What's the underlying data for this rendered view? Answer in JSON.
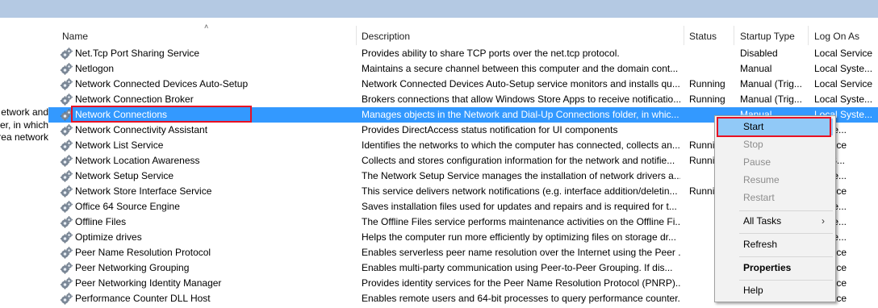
{
  "left_pane": {
    "lines": [
      "etwork and",
      "er, in which",
      "rea network"
    ]
  },
  "columns": {
    "name": "Name",
    "description": "Description",
    "status": "Status",
    "startup_type": "Startup Type",
    "log_on_as": "Log On As"
  },
  "services": [
    {
      "name": "Net.Tcp Port Sharing Service",
      "description": "Provides ability to share TCP ports over the net.tcp protocol.",
      "status": "",
      "startup": "Disabled",
      "logon": "Local Service"
    },
    {
      "name": "Netlogon",
      "description": "Maintains a secure channel between this computer and the domain cont...",
      "status": "",
      "startup": "Manual",
      "logon": "Local Syste..."
    },
    {
      "name": "Network Connected Devices Auto-Setup",
      "description": "Network Connected Devices Auto-Setup service monitors and installs qu...",
      "status": "Running",
      "startup": "Manual (Trig...",
      "logon": "Local Service"
    },
    {
      "name": "Network Connection Broker",
      "description": "Brokers connections that allow Windows Store Apps to receive notificatio...",
      "status": "Running",
      "startup": "Manual (Trig...",
      "logon": "Local Syste..."
    },
    {
      "name": "Network Connections",
      "description": "Manages objects in the Network and Dial-Up Connections folder, in whic...",
      "status": "",
      "startup": "Manual",
      "logon": "Local Syste..."
    },
    {
      "name": "Network Connectivity Assistant",
      "description": "Provides DirectAccess status notification for UI components",
      "status": "",
      "startup": "",
      "logon": "Syste..."
    },
    {
      "name": "Network List Service",
      "description": "Identifies the networks to which the computer has connected, collects an...",
      "status": "Runni",
      "startup": "",
      "logon": "Service"
    },
    {
      "name": "Network Location Awareness",
      "description": "Collects and stores configuration information for the network and notifie...",
      "status": "Runni",
      "startup": "",
      "logon": "ork S..."
    },
    {
      "name": "Network Setup Service",
      "description": "The Network Setup Service manages the installation of network drivers a...",
      "status": "",
      "startup": "",
      "logon": "Syste..."
    },
    {
      "name": "Network Store Interface Service",
      "description": "This service delivers network notifications (e.g. interface addition/deletin...",
      "status": "Runni",
      "startup": "",
      "logon": "Service"
    },
    {
      "name": "Office 64 Source Engine",
      "description": "Saves installation files used for updates and repairs and is required for t...",
      "status": "",
      "startup": "",
      "logon": "Syste..."
    },
    {
      "name": "Offline Files",
      "description": "The Offline Files service performs maintenance activities on the Offline Fi...",
      "status": "",
      "startup": "",
      "logon": "Syste..."
    },
    {
      "name": "Optimize drives",
      "description": "Helps the computer run more efficiently by optimizing files on storage dr...",
      "status": "",
      "startup": "",
      "logon": "Syste..."
    },
    {
      "name": "Peer Name Resolution Protocol",
      "description": "Enables serverless peer name resolution over the Internet using the Peer ...",
      "status": "",
      "startup": "",
      "logon": "Service"
    },
    {
      "name": "Peer Networking Grouping",
      "description": "Enables multi-party communication using Peer-to-Peer Grouping.  If dis...",
      "status": "",
      "startup": "",
      "logon": "Service"
    },
    {
      "name": "Peer Networking Identity Manager",
      "description": "Provides identity services for the Peer Name Resolution Protocol (PNRP)...",
      "status": "",
      "startup": "",
      "logon": "Service"
    },
    {
      "name": "Performance Counter DLL Host",
      "description": "Enables remote users and 64-bit processes to query performance counter...",
      "status": "",
      "startup": "",
      "logon": "Service"
    }
  ],
  "selected_index": 4,
  "context_menu": {
    "start": "Start",
    "stop": "Stop",
    "pause": "Pause",
    "resume": "Resume",
    "restart": "Restart",
    "all_tasks": "All Tasks",
    "refresh": "Refresh",
    "properties": "Properties",
    "help": "Help"
  },
  "colors": {
    "selection": "#3399ff",
    "menu_hover": "#91c9f7",
    "highlight_border": "#e81123",
    "titlebar": "#b4c9e3"
  },
  "icons": {
    "service": "gear-icon",
    "submenu": "chevron-right-icon",
    "sort": "sort-ascending-icon"
  }
}
